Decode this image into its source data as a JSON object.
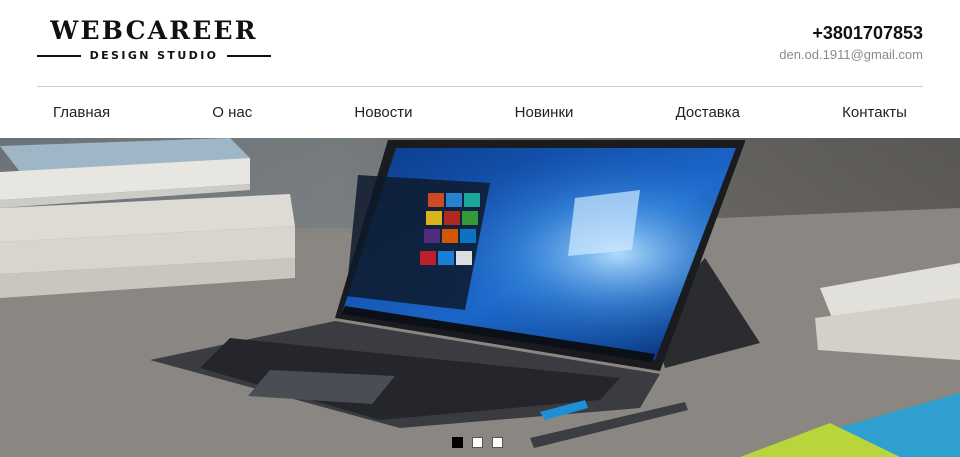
{
  "brand": {
    "name": "WEBCAREER",
    "tagline": "DESIGN STUDIO"
  },
  "contact": {
    "phone": "+3801707853",
    "email": "den.od.1911@gmail.com"
  },
  "nav": [
    {
      "label": "Главная"
    },
    {
      "label": "О нас"
    },
    {
      "label": "Новости"
    },
    {
      "label": "Новинки"
    },
    {
      "label": "Доставка"
    },
    {
      "label": "Контакты"
    }
  ],
  "slider": {
    "slide_count": 3,
    "active_index": 0
  }
}
